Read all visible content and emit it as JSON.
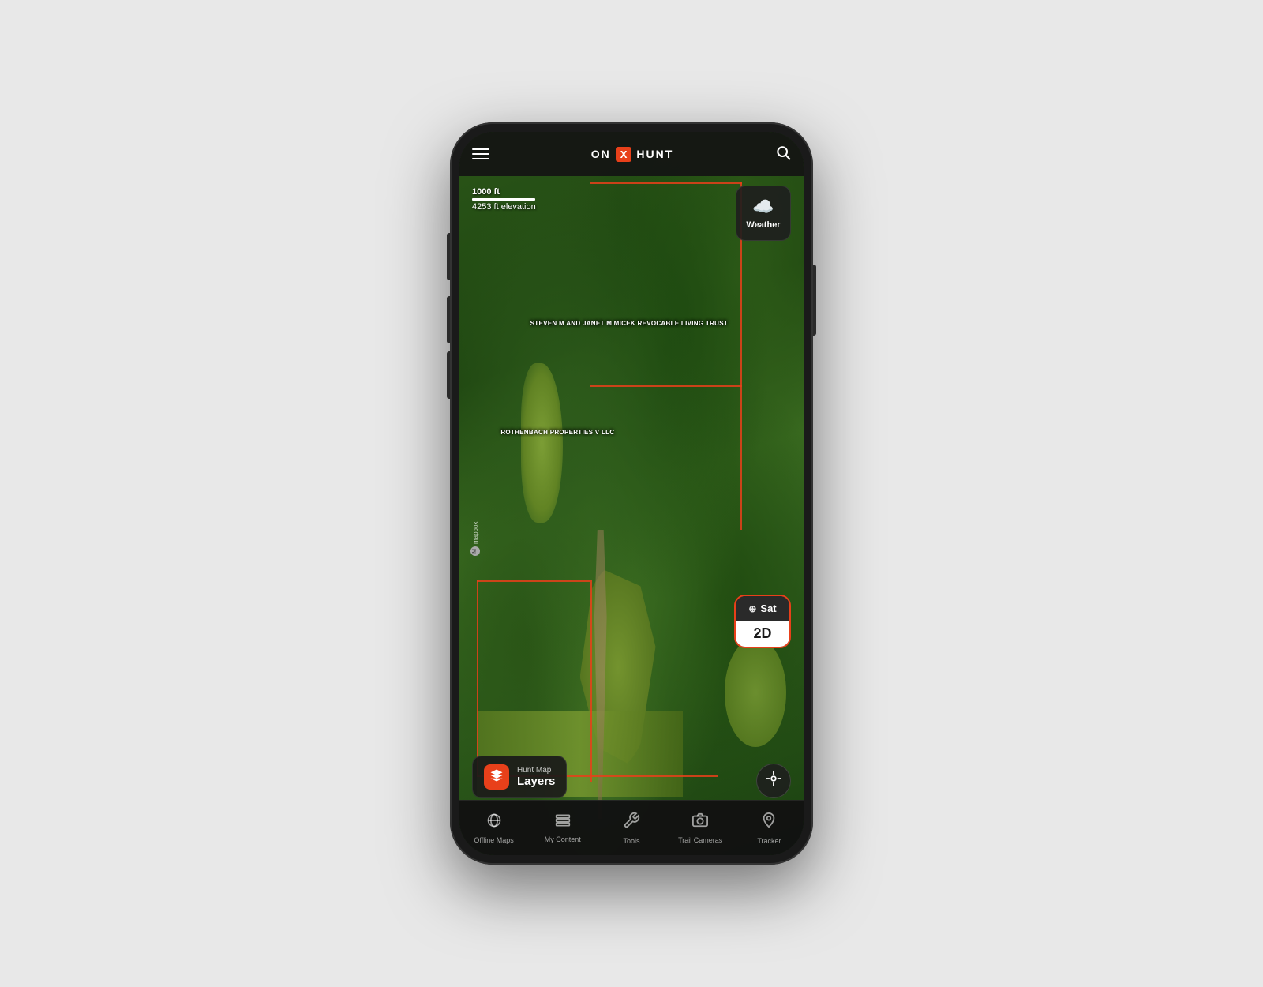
{
  "app": {
    "title": "onX Hunt",
    "logo": {
      "on": "ON",
      "x": "X",
      "hunt": "HUNT"
    }
  },
  "header": {
    "hamburger_label": "Menu",
    "search_label": "Search"
  },
  "map": {
    "scale_distance": "1000 ft",
    "elevation": "4253 ft elevation",
    "property_labels": [
      {
        "name": "steven-label",
        "text": "STEVEN M AND JANET M MICEK REVOCABLE LIVING TRUST"
      },
      {
        "name": "rothen-label",
        "text": "ROTHENBACH PROPERTIES V LLC"
      }
    ],
    "mapbox_attribution": "mapbox"
  },
  "weather_button": {
    "icon": "☁️",
    "label": "Weather"
  },
  "map_type_button": {
    "type": "Sat",
    "dimension": "2D",
    "compass_icon": "⊕"
  },
  "hunt_layers_button": {
    "sub_label": "Hunt Map",
    "main_label": "Layers"
  },
  "bottom_nav": {
    "items": [
      {
        "id": "offline-maps",
        "icon": "((·))",
        "label": "Offline Maps"
      },
      {
        "id": "my-content",
        "icon": "☰",
        "label": "My Content"
      },
      {
        "id": "tools",
        "icon": "✦",
        "label": "Tools"
      },
      {
        "id": "trail-cameras",
        "icon": "▣",
        "label": "Trail Cameras"
      },
      {
        "id": "tracker",
        "icon": "⌖",
        "label": "Tracker"
      }
    ]
  },
  "colors": {
    "accent": "#e8401a",
    "nav_bg": "#121212",
    "map_overlay_bg": "rgba(25,25,25,0.92)"
  }
}
